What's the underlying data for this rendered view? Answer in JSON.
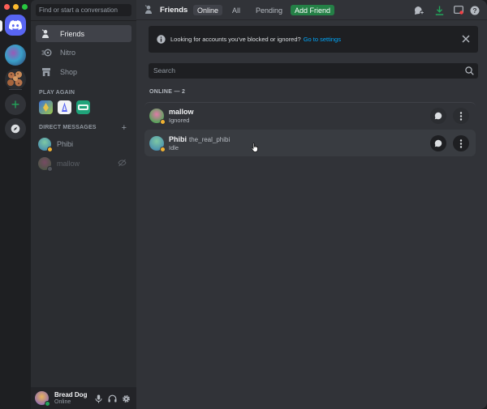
{
  "window": {
    "traffic_colors": [
      "#ff5f57",
      "#febc2e",
      "#28c840"
    ]
  },
  "sidebar": {
    "search_placeholder": "Find or start a conversation",
    "nav": [
      {
        "label": "Friends",
        "icon": "friends-icon",
        "active": true
      },
      {
        "label": "Nitro",
        "icon": "nitro-icon",
        "active": false
      },
      {
        "label": "Shop",
        "icon": "shop-icon",
        "active": false
      }
    ],
    "play_again_title": "PLAY AGAIN",
    "dm_title": "DIRECT MESSAGES",
    "dm_add": "+",
    "dms": [
      {
        "name": "Phibi",
        "status": "idle"
      },
      {
        "name": "mallow",
        "status": "offline",
        "ignored": true
      }
    ]
  },
  "user_panel": {
    "name": "Bread Dog",
    "status": "Online"
  },
  "header": {
    "title": "Friends",
    "tabs": [
      "Online",
      "All",
      "Pending"
    ],
    "selected_tab": "Online",
    "add_friend": "Add Friend"
  },
  "notice": {
    "text": "Looking for accounts you've blocked or ignored?",
    "link": "Go to settings"
  },
  "friends": {
    "search_placeholder": "Search",
    "online_header": "ONLINE — 2",
    "rows": [
      {
        "name": "mallow",
        "tag": "",
        "sub": "Ignored"
      },
      {
        "name": "Phibi",
        "tag": "the_real_phibi",
        "sub": "Idle"
      }
    ]
  },
  "colors": {
    "brand": "#5865f2",
    "online": "#23a55a",
    "idle": "#f0b232",
    "add_friend_bg": "#248046",
    "link": "#00a8fc"
  }
}
